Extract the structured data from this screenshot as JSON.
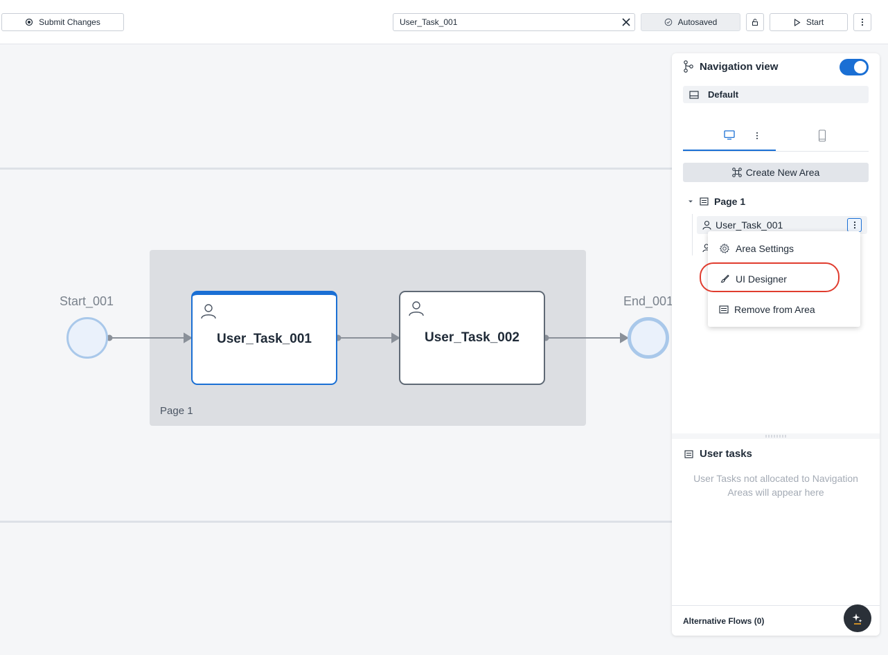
{
  "toolbar": {
    "submit_label": "Submit Changes",
    "search_value": "User_Task_001",
    "autosave_label": "Autosaved",
    "start_label": "Start"
  },
  "canvas": {
    "start_event_label": "Start_001",
    "end_event_label": "End_001",
    "area_label": "Page 1",
    "tasks": [
      {
        "label": "User_Task_001",
        "selected": true
      },
      {
        "label": "User_Task_002",
        "selected": false
      }
    ]
  },
  "panel": {
    "title": "Navigation view",
    "toggle_on": true,
    "layout_name": "Default",
    "create_area_label": "Create New Area",
    "tree": {
      "page_label": "Page 1",
      "items": [
        {
          "label": "User_Task_001"
        }
      ]
    },
    "user_tasks_title": "User tasks",
    "user_tasks_empty": "User Tasks not allocated to Navigation Areas will appear here",
    "alt_flows_label": "Alternative Flows (0)"
  },
  "context_menu": {
    "items": [
      {
        "label": "Area Settings",
        "icon": "gear-icon"
      },
      {
        "label": "UI Designer",
        "icon": "brush-icon",
        "highlighted": true
      },
      {
        "label": "Remove from Area",
        "icon": "list-icon"
      }
    ]
  },
  "colors": {
    "accent": "#1a6fd4",
    "highlight": "#e03c2e",
    "area_fill": "#dcdee2"
  }
}
